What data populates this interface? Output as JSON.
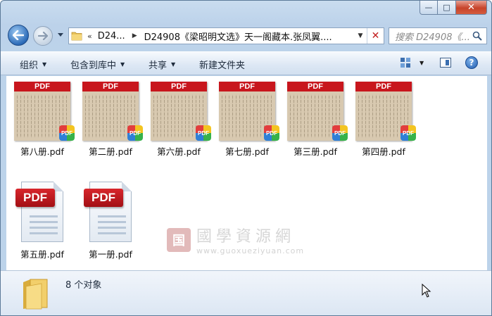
{
  "window": {
    "caption": {
      "minimize": "—",
      "maximize": "□",
      "close": "✕"
    }
  },
  "nav": {
    "address": {
      "chevron": "«",
      "segments": [
        "D24...",
        "D24908《梁昭明文选》天一阁藏本.张凤翼...."
      ],
      "dropdown": "▼",
      "stop": "✕"
    },
    "search": {
      "placeholder": "搜索 D24908《..."
    }
  },
  "toolbar": {
    "organize": "组织",
    "include_library": "包含到库中",
    "share": "共享",
    "new_folder": "新建文件夹"
  },
  "files": [
    {
      "name": "第八册.pdf",
      "kind": "thumbnail"
    },
    {
      "name": "第二册.pdf",
      "kind": "thumbnail"
    },
    {
      "name": "第六册.pdf",
      "kind": "thumbnail"
    },
    {
      "name": "第七册.pdf",
      "kind": "thumbnail"
    },
    {
      "name": "第三册.pdf",
      "kind": "thumbnail"
    },
    {
      "name": "第四册.pdf",
      "kind": "thumbnail"
    },
    {
      "name": "第五册.pdf",
      "kind": "pdf-icon"
    },
    {
      "name": "第一册.pdf",
      "kind": "pdf-icon"
    }
  ],
  "thumb_banner": "PDF",
  "badge_label": "PDF",
  "icon_label": "PDF",
  "watermark": {
    "seal": "国",
    "cn": "國學資源網",
    "url": "www.guoxueziyuan.com"
  },
  "status": {
    "item_count": "8 个对象"
  },
  "help_glyph": "?",
  "colors": {
    "accent": "#c8161d",
    "chrome": "#bcd3ea",
    "close": "#c7432a"
  }
}
